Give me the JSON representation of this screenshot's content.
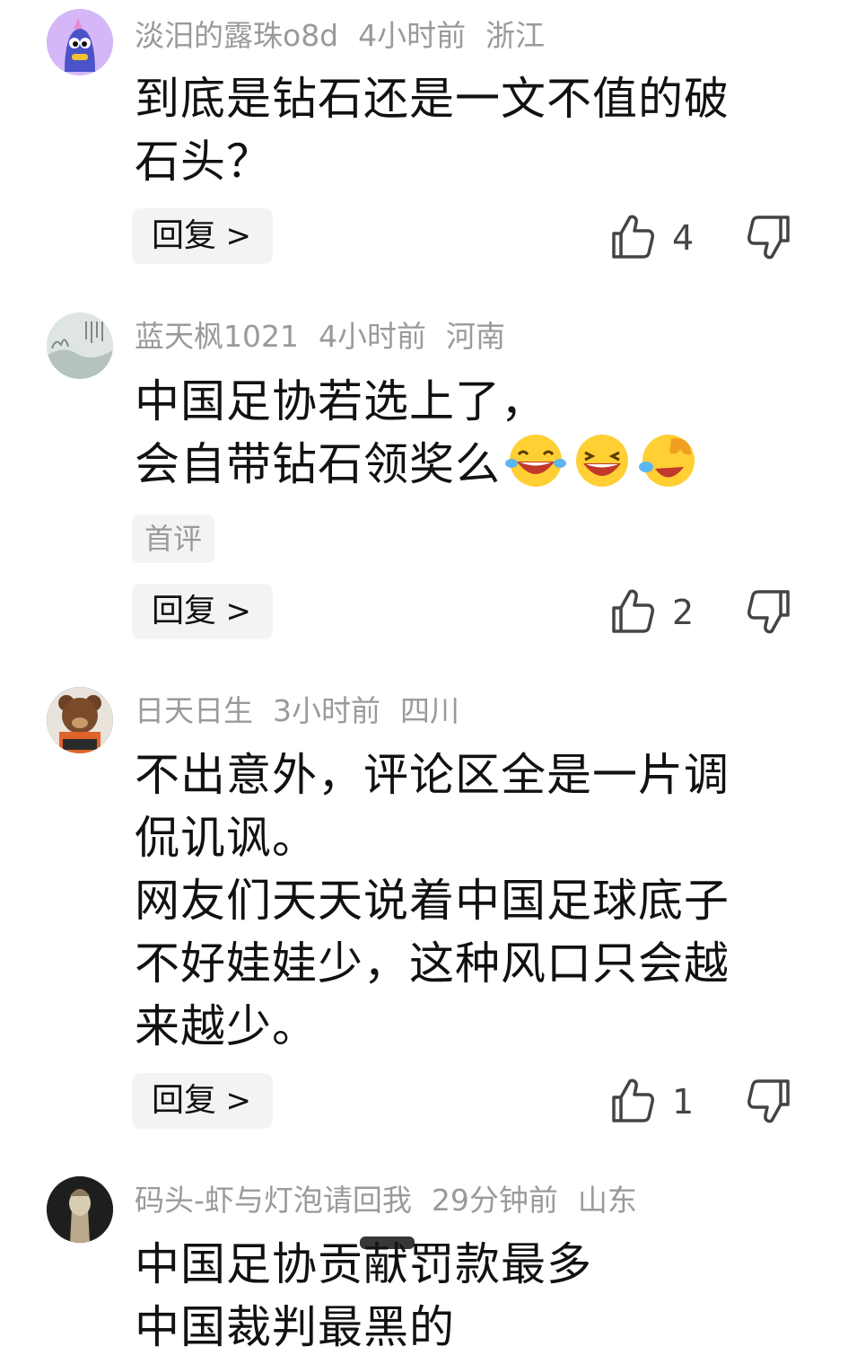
{
  "comments": [
    {
      "username": "淡汨的露珠o8d",
      "time": "4小时前",
      "location": "浙江",
      "lines": [
        "到底是钻石还是一文不值的破",
        "石头？"
      ],
      "reply_label": "回复",
      "likes": "4",
      "avatar_icon": "cartoon-avatar-purple-icon"
    },
    {
      "username": "蓝天枫1021",
      "time": "4小时前",
      "location": "河南",
      "lines": [
        "中国足协若选上了，",
        "会自带钻石领奖么"
      ],
      "emojis": [
        "laugh-cry-emoji-icon",
        "grin-emoji-icon",
        "rofl-emoji-icon"
      ],
      "tag": "首评",
      "reply_label": "回复",
      "likes": "2",
      "avatar_icon": "landscape-avatar-icon"
    },
    {
      "username": "日天日生",
      "time": "3小时前",
      "location": "四川",
      "lines": [
        "不出意外，评论区全是一片调",
        "侃讥讽。",
        "网友们天天说着中国足球底子",
        "不好娃娃少，这种风口只会越",
        "来越少。"
      ],
      "reply_label": "回复",
      "likes": "1",
      "avatar_icon": "bear-avatar-icon"
    },
    {
      "username": "码头-虾与灯泡请回我",
      "time": "29分钟前",
      "location": "山东",
      "lines_parts": {
        "l1a": "中国足协贡",
        "l1b": "献",
        "l1c": "罚款最多",
        "l2": "中国裁判最黑的"
      },
      "avatar_icon": "statue-avatar-icon"
    }
  ],
  "colors": {
    "text": "#111111",
    "meta": "#9a9a9a",
    "button_bg": "#f3f3f3"
  }
}
